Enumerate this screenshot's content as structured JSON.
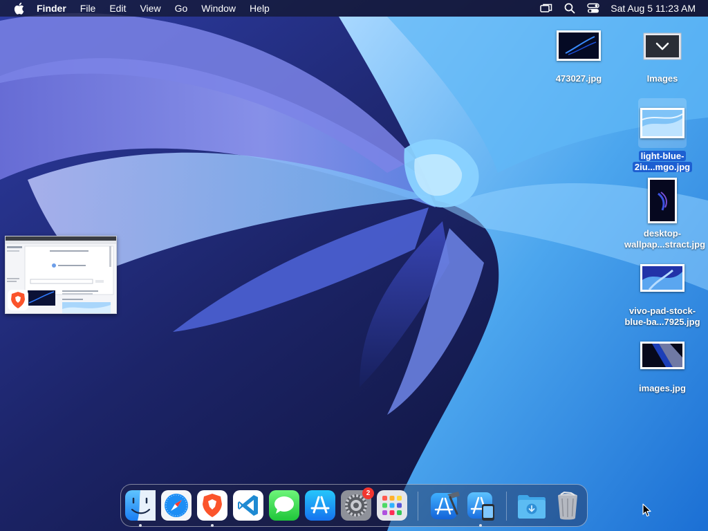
{
  "menubar": {
    "app_name": "Finder",
    "menus": [
      "File",
      "Edit",
      "View",
      "Go",
      "Window",
      "Help"
    ],
    "status_icons": [
      "screen-mirroring-icon",
      "search-icon",
      "control-center-icon"
    ],
    "clock": "Sat Aug 5  11:23 AM"
  },
  "desktop": {
    "icons": [
      {
        "name": "473027.jpg",
        "kind": "image-file"
      },
      {
        "name": "Images",
        "kind": "folder"
      },
      {
        "name": "light-blue-2iu...mgo.jpg",
        "kind": "image-file",
        "selected": true
      },
      {
        "name": "desktop-wallpap...stract.jpg",
        "kind": "image-file"
      },
      {
        "name": "vivo-pad-stock-blue-ba...7925.jpg",
        "kind": "image-file"
      },
      {
        "name": "images.jpg",
        "kind": "image-file"
      }
    ]
  },
  "dock": {
    "apps": [
      {
        "name": "Finder",
        "icon": "finder-icon",
        "running": true
      },
      {
        "name": "Safari",
        "icon": "safari-icon",
        "running": false
      },
      {
        "name": "Brave Browser",
        "icon": "brave-icon",
        "running": true
      },
      {
        "name": "Visual Studio Code",
        "icon": "vscode-icon",
        "running": false
      },
      {
        "name": "Messages",
        "icon": "messages-icon",
        "running": false
      },
      {
        "name": "App Store",
        "icon": "app-store-icon",
        "running": false
      },
      {
        "name": "System Settings",
        "icon": "system-settings-icon",
        "running": false,
        "badge": "2"
      },
      {
        "name": "Launchpad",
        "icon": "launchpad-icon",
        "running": false
      },
      {
        "name": "Xcode",
        "icon": "xcode-icon",
        "running": false
      },
      {
        "name": "Simulator",
        "icon": "simulator-icon",
        "running": true
      },
      {
        "name": "Downloads",
        "icon": "downloads-folder-icon",
        "running": false
      },
      {
        "name": "Trash",
        "icon": "trash-icon",
        "running": false
      }
    ]
  },
  "colors": {
    "menubar_bg": "#12162c",
    "selection": "#1d5fd1",
    "badge": "#f2362f"
  }
}
